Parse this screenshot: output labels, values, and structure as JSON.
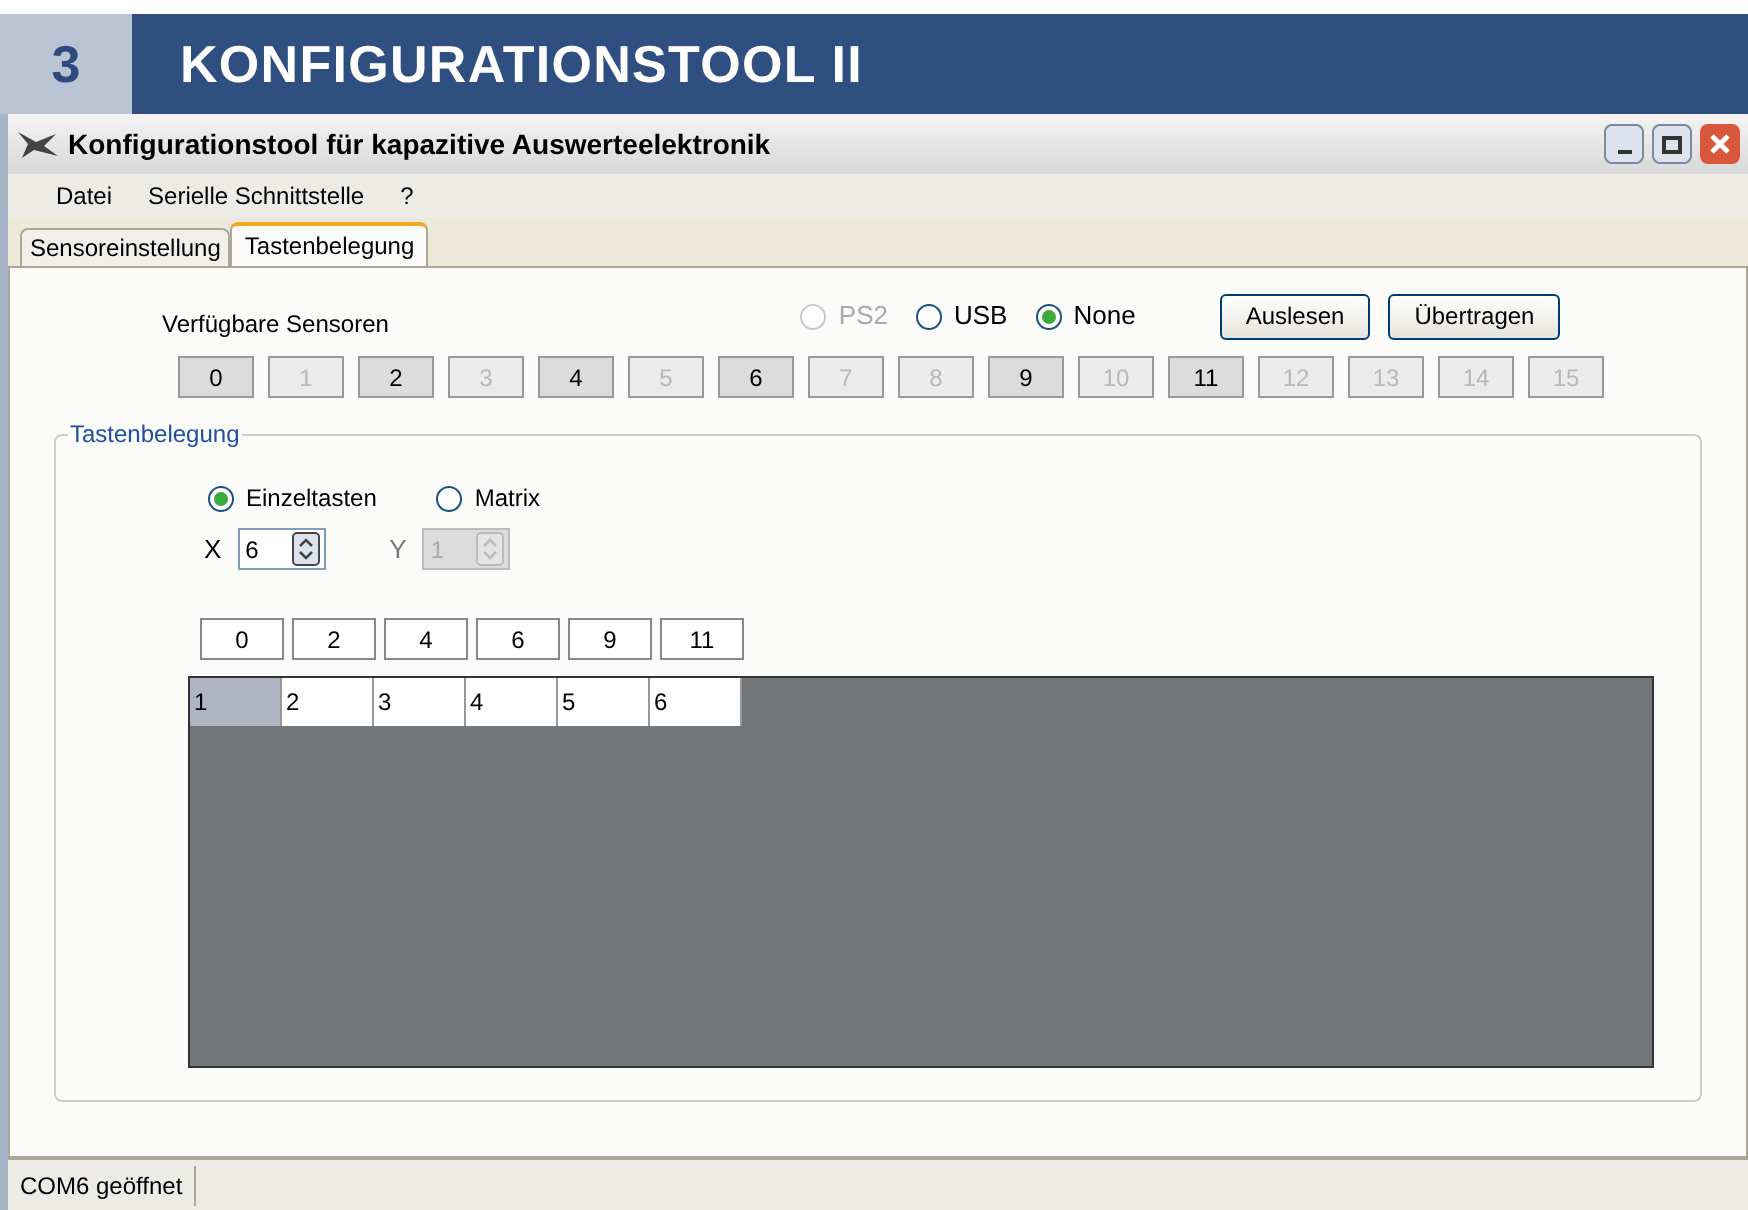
{
  "section": {
    "number": "3",
    "title": "KONFIGURATIONSTOOL II"
  },
  "window": {
    "title": "Konfigurationstool für kapazitive Auswerteelektronik"
  },
  "menu": [
    "Datei",
    "Serielle Schnittstelle",
    "?"
  ],
  "tabs": [
    {
      "label": "Sensoreinstellung",
      "selected": false
    },
    {
      "label": "Tastenbelegung",
      "selected": true
    }
  ],
  "sensors_label": "Verfügbare Sensoren",
  "interface": [
    {
      "label": "PS2",
      "selected": false,
      "disabled": true
    },
    {
      "label": "USB",
      "selected": false,
      "disabled": false
    },
    {
      "label": "None",
      "selected": true,
      "disabled": false
    }
  ],
  "buttons": [
    "Auslesen",
    "Übertragen"
  ],
  "sensors": [
    {
      "label": "0",
      "disabled": false
    },
    {
      "label": "1",
      "disabled": true
    },
    {
      "label": "2",
      "disabled": false
    },
    {
      "label": "3",
      "disabled": true
    },
    {
      "label": "4",
      "disabled": false
    },
    {
      "label": "5",
      "disabled": true
    },
    {
      "label": "6",
      "disabled": false
    },
    {
      "label": "7",
      "disabled": true
    },
    {
      "label": "8",
      "disabled": true
    },
    {
      "label": "9",
      "disabled": false
    },
    {
      "label": "10",
      "disabled": true
    },
    {
      "label": "11",
      "disabled": false
    },
    {
      "label": "12",
      "disabled": true
    },
    {
      "label": "13",
      "disabled": true
    },
    {
      "label": "14",
      "disabled": true
    },
    {
      "label": "15",
      "disabled": true
    }
  ],
  "group": {
    "title": "Tastenbelegung",
    "modes": [
      {
        "label": "Einzeltasten",
        "selected": true
      },
      {
        "label": "Matrix",
        "selected": false
      }
    ],
    "spinners": [
      {
        "label": "X",
        "value": "6",
        "disabled": false
      },
      {
        "label": "Y",
        "value": "1",
        "disabled": true
      }
    ],
    "columns": [
      "0",
      "2",
      "4",
      "6",
      "9",
      "11"
    ],
    "cells": [
      {
        "text": "1",
        "selected": true
      },
      {
        "text": "2",
        "selected": false
      },
      {
        "text": "3",
        "selected": false
      },
      {
        "text": "4",
        "selected": false
      },
      {
        "text": "5",
        "selected": false
      },
      {
        "text": "6",
        "selected": false
      }
    ]
  },
  "status_bar": "COM6 geöffnet"
}
